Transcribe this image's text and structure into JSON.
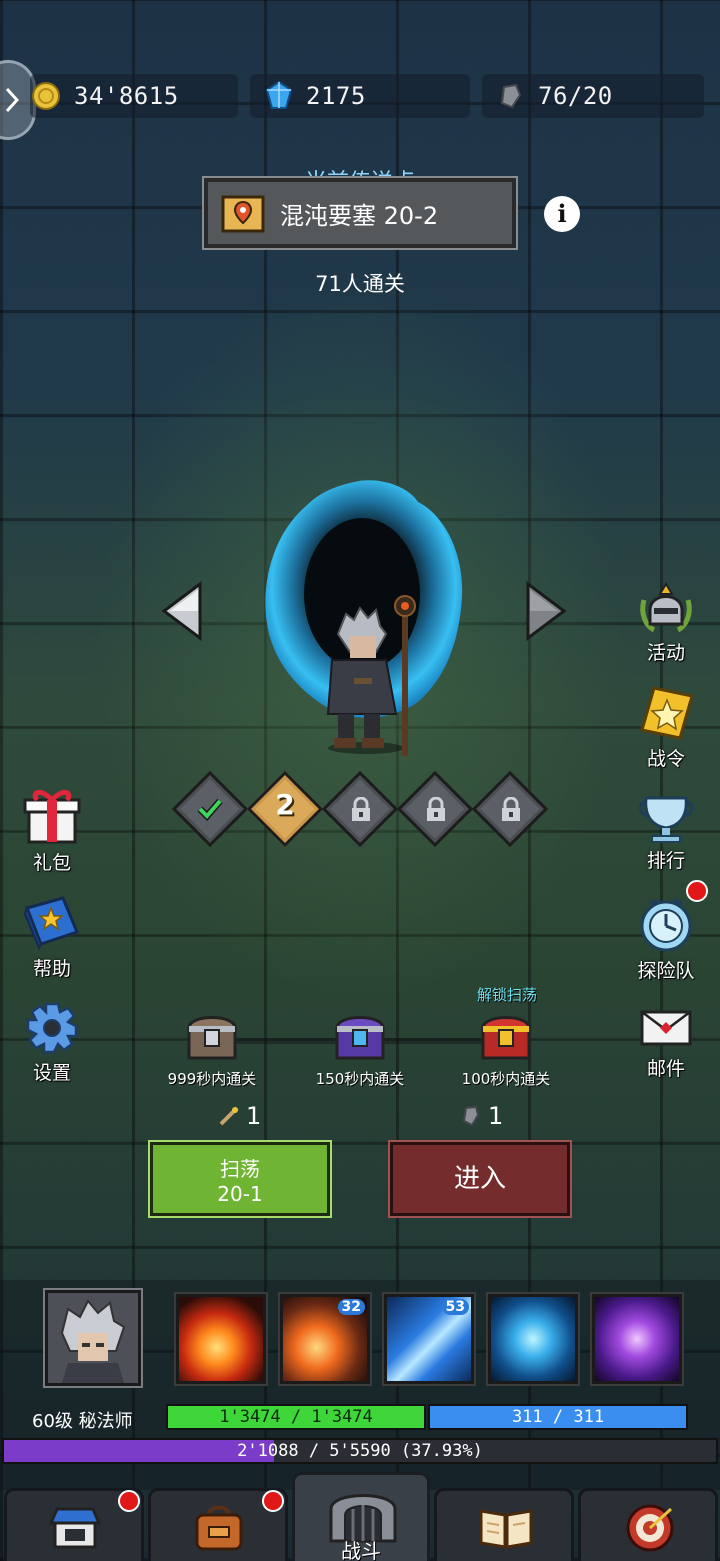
{
  "resources": {
    "gold": "34'8615",
    "gems": "2175",
    "stamina": "76/20"
  },
  "teleport": {
    "label": "当前传送点",
    "location": "混沌要塞 20-2",
    "clear_count": "71人通关"
  },
  "stages": [
    "cleared",
    "2",
    "locked",
    "locked",
    "locked"
  ],
  "side_left": [
    {
      "label": "礼包",
      "icon": "gift-icon"
    },
    {
      "label": "帮助",
      "icon": "book-icon"
    },
    {
      "label": "设置",
      "icon": "gear-icon"
    }
  ],
  "side_right": [
    {
      "label": "活动",
      "icon": "helmet-icon"
    },
    {
      "label": "战令",
      "icon": "star-badge-icon"
    },
    {
      "label": "排行",
      "icon": "trophy-icon"
    },
    {
      "label": "探险队",
      "icon": "clock-icon"
    },
    {
      "label": "邮件",
      "icon": "mail-icon"
    }
  ],
  "chests": {
    "unlock_label": "解锁扫荡",
    "items": [
      {
        "label": "999秒内通关",
        "tier": "silver"
      },
      {
        "label": "150秒内通关",
        "tier": "purple"
      },
      {
        "label": "100秒内通关",
        "tier": "gold"
      }
    ]
  },
  "costs": {
    "sweep": "1",
    "enter": "1"
  },
  "buttons": {
    "sweep_line1": "扫荡",
    "sweep_line2": "20-1",
    "enter": "进入"
  },
  "skills": [
    {
      "icon": "fireball-icon",
      "level": ""
    },
    {
      "icon": "meteor-icon",
      "level": "32"
    },
    {
      "icon": "ice-shards-icon",
      "level": "53"
    },
    {
      "icon": "lightning-dash-icon",
      "level": ""
    },
    {
      "icon": "arcane-vortex-icon",
      "level": ""
    }
  ],
  "player": {
    "level_class": "60级 秘法师",
    "hp": "1'3474 / 1'3474",
    "mp": "311 / 311",
    "exp": "2'1088 / 5'5590 (37.93%)",
    "exp_fraction": 0.3793
  },
  "nav": {
    "battle_label": "战斗"
  },
  "colors": {
    "hp": "#3fd63a",
    "mp": "#3a8ef0",
    "exp": "#7a3cc9",
    "sweep": "#6fb432",
    "enter": "#742c2c",
    "teleport_label": "#8fd7ff"
  }
}
